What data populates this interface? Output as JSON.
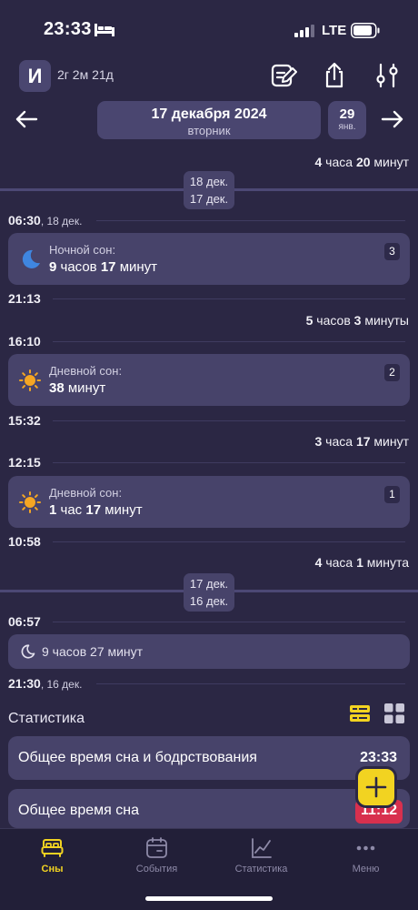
{
  "status_bar": {
    "time": "23:33",
    "network": "LTE"
  },
  "header": {
    "avatar_letter": "И",
    "child_age": "2г 2м 21д"
  },
  "date_nav": {
    "date": "17 декабря 2024",
    "weekday": "вторник",
    "next_day": "29",
    "next_month": "янв."
  },
  "timeline": {
    "top_duration_num1": "4",
    "top_duration_word1": "часа",
    "top_duration_num2": "20",
    "top_duration_word2": "минут",
    "sep1_line1": "18 дек.",
    "sep1_line2": "17 дек.",
    "t1_time": "06:30",
    "t1_sub": ", 18 дек.",
    "card1": {
      "title": "Ночной сон:",
      "num1": "9",
      "word1": "часов",
      "num2": "17",
      "word2": "минут",
      "badge": "3"
    },
    "t2_time": "21:13",
    "gap1_num1": "5",
    "gap1_word1": "часов",
    "gap1_num2": "3",
    "gap1_word2": "минуты",
    "t3_time": "16:10",
    "card2": {
      "title": "Дневной сон:",
      "num1": "38",
      "word1": "минут",
      "badge": "2"
    },
    "t4_time": "15:32",
    "gap2_num1": "3",
    "gap2_word1": "часа",
    "gap2_num2": "17",
    "gap2_word2": "минут",
    "t5_time": "12:15",
    "card3": {
      "title": "Дневной сон:",
      "num1": "1",
      "word1": "час",
      "num2": "17",
      "word2": "минут",
      "badge": "1"
    },
    "t6_time": "10:58",
    "gap3_num1": "4",
    "gap3_word1": "часа",
    "gap3_num2": "1",
    "gap3_word2": "минута",
    "sep2_line1": "17 дек.",
    "sep2_line2": "16 дек.",
    "t7_time": "06:57",
    "compact_text": "9 часов 27 минут",
    "t8_time": "21:30",
    "t8_sub": ", 16 дек."
  },
  "stats": {
    "title": "Статистика",
    "rows": [
      {
        "label": "Общее время сна и бодрствования",
        "value": "23:33"
      },
      {
        "label": "Общее время сна",
        "value": "11:12"
      }
    ]
  },
  "tabs": [
    {
      "label": "Сны",
      "icon": "bed-icon",
      "active": true
    },
    {
      "label": "События",
      "icon": "calendar-icon",
      "active": false
    },
    {
      "label": "Статистика",
      "icon": "chart-icon",
      "active": false
    },
    {
      "label": "Меню",
      "icon": "more-icon",
      "active": false
    }
  ],
  "colors": {
    "background": "#2b2744",
    "card": "#47436a",
    "accent": "#f2d321",
    "alert": "#d8304e",
    "moon": "#3f86e0",
    "sun": "#f5a623"
  }
}
